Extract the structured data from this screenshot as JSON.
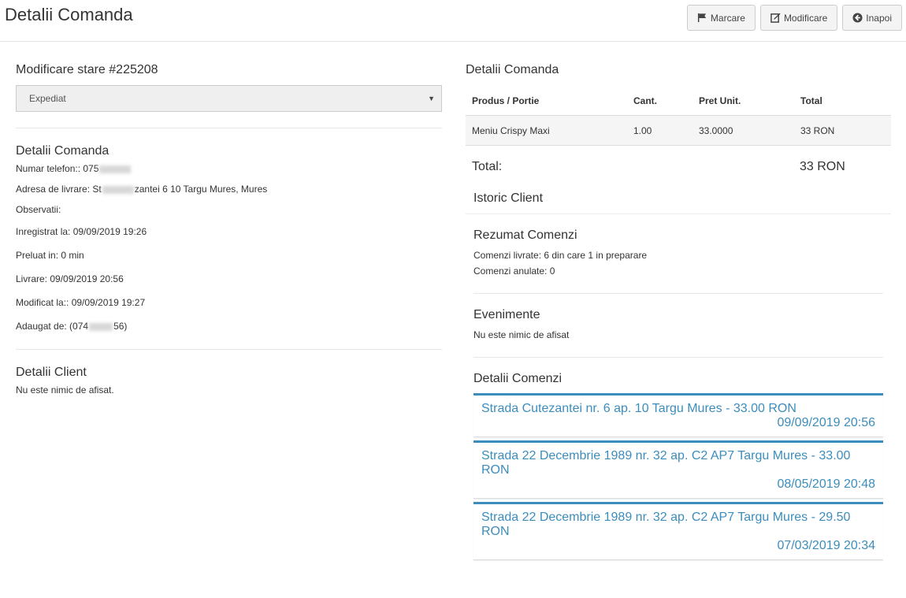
{
  "header": {
    "title": "Detalii Comanda",
    "buttons": {
      "mark": "Marcare",
      "edit": "Modificare",
      "back": "Inapoi"
    }
  },
  "status": {
    "title": "Modificare stare #225208",
    "selected": "Expediat"
  },
  "order_details": {
    "title": "Detalii Comanda",
    "phone_prefix": "Numar telefon:: 075",
    "address_prefix": "Adresa de livrare: St",
    "address_suffix": "zantei 6 10 Targu Mures, Mures",
    "observations": "Observatii:",
    "registered": "Inregistrat la: 09/09/2019 19:26",
    "taken": "Preluat in: 0 min",
    "delivery": "Livrare: 09/09/2019 20:56",
    "modified": "Modificat la:: 09/09/2019 19:27",
    "added_prefix": "Adaugat de: (074",
    "added_suffix": "56)"
  },
  "client": {
    "title": "Detalii Client",
    "empty": "Nu este nimic de afisat."
  },
  "order_table": {
    "title": "Detalii Comanda",
    "headers": [
      "Produs / Portie",
      "Cant.",
      "Pret Unit.",
      "Total"
    ],
    "rows": [
      {
        "product": "Meniu Crispy Maxi",
        "qty": "1.00",
        "unit": "33.0000",
        "total": "33 RON"
      }
    ],
    "total_label": "Total:",
    "total_value": "33 RON"
  },
  "history": {
    "title": "Istoric Client",
    "summary_title": "Rezumat Comenzi",
    "delivered": "Comenzi livrate: 6 din care 1 in preparare",
    "cancelled": "Comenzi anulate: 0",
    "events_title": "Evenimente",
    "events_empty": "Nu este nimic de afisat",
    "orders_title": "Detalii Comenzi",
    "orders": [
      {
        "address": "Strada Cutezantei nr. 6 ap. 10 Targu Mures - 33.00 RON",
        "date": "09/09/2019 20:56"
      },
      {
        "address": "Strada 22 Decembrie 1989 nr. 32 ap. C2 AP7 Targu Mures - 33.00 RON",
        "date": "08/05/2019 20:48"
      },
      {
        "address": "Strada 22 Decembrie 1989 nr. 32 ap. C2 AP7 Targu Mures - 29.50 RON",
        "date": "07/03/2019 20:34"
      }
    ]
  }
}
